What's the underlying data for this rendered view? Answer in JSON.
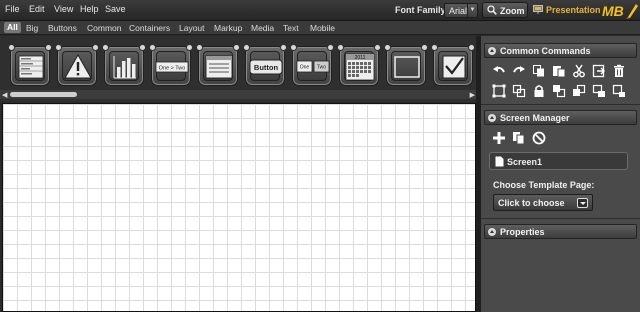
{
  "menu": [
    "File",
    "Edit",
    "View",
    "Help",
    "Save"
  ],
  "toolbar": {
    "font_family_label": "Font Family:",
    "font_family_value": "Arial",
    "zoom_label": "Zoom",
    "presentation_label": "Presentation",
    "logo_text": "MB"
  },
  "tabs": [
    "All",
    "Big",
    "Buttons",
    "Common",
    "Containers",
    "Layout",
    "Markup",
    "Media",
    "Text",
    "Mobile"
  ],
  "active_tab": "All",
  "widgets": [
    {
      "icon": "list-box-icon"
    },
    {
      "icon": "alert-icon"
    },
    {
      "icon": "bar-chart-icon"
    },
    {
      "icon": "breadcrumb-icon",
      "text": "One > Two"
    },
    {
      "icon": "window-icon"
    },
    {
      "icon": "button-icon",
      "text": "Button"
    },
    {
      "icon": "tabs-icon",
      "text_a": "One",
      "text_b": "Two"
    },
    {
      "icon": "calendar-icon",
      "text": "2011"
    },
    {
      "icon": "rectangle-icon"
    },
    {
      "icon": "checkbox-icon"
    }
  ],
  "panel": {
    "common_commands_title": "Common Commands",
    "screen_manager_title": "Screen Manager",
    "screen_name": "Screen1",
    "template_label": "Choose Template Page:",
    "template_value": "Click to choose",
    "properties_title": "Properties"
  },
  "colors": {
    "accent_presentation": "#e7b23a",
    "logo_yellow": "#f2c21a",
    "panel_bg": "#4a4a4a",
    "canvas_grid": "#dcdcdc"
  }
}
